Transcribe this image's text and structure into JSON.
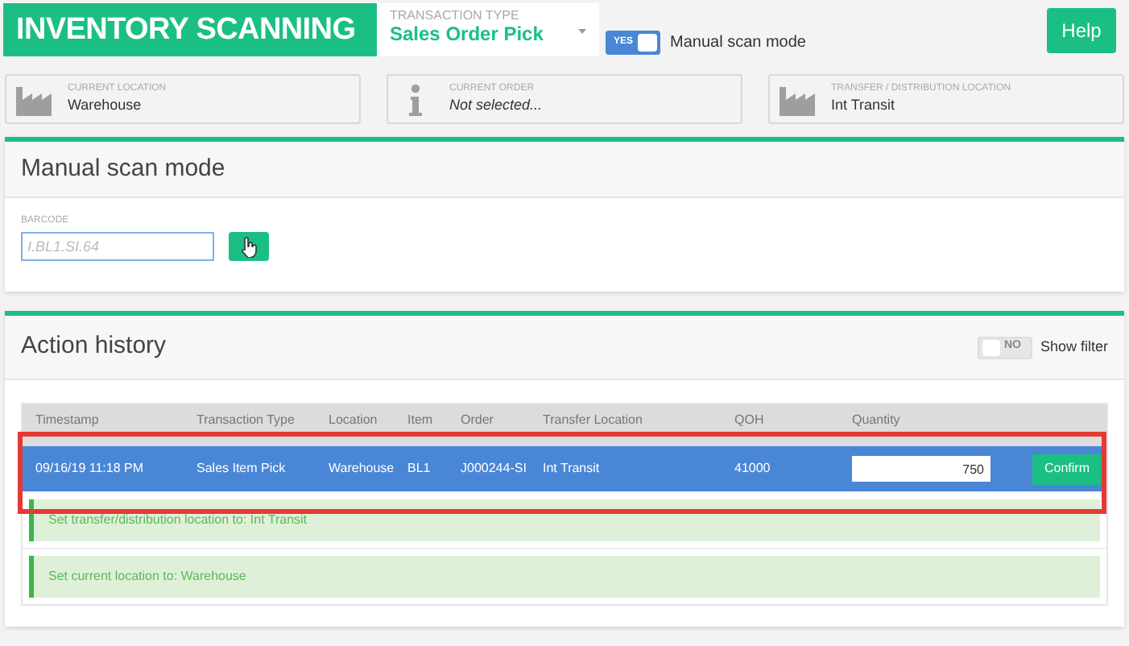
{
  "header": {
    "title": "INVENTORY SCANNING",
    "transaction_type": {
      "label": "TRANSACTION TYPE",
      "value": "Sales Order Pick"
    },
    "manual_toggle": {
      "on": true,
      "on_text": "YES",
      "label": "Manual scan mode"
    },
    "help_button": "Help"
  },
  "info_cards": [
    {
      "kind": "factory",
      "label": "CURRENT LOCATION",
      "value": "Warehouse",
      "italic": false
    },
    {
      "kind": "info",
      "label": "CURRENT ORDER",
      "value": "Not selected...",
      "italic": true
    },
    {
      "kind": "factory",
      "label": "TRANSFER / DISTRIBUTION LOCATION",
      "value": "Int Transit",
      "italic": false
    }
  ],
  "manual_panel": {
    "title": "Manual scan mode",
    "barcode": {
      "label": "BARCODE",
      "placeholder": "I.BL1.SI.64"
    }
  },
  "history_panel": {
    "title": "Action history",
    "filter_toggle": {
      "on": false,
      "off_text": "NO",
      "label": "Show filter"
    },
    "table": {
      "columns": [
        "Timestamp",
        "Transaction Type",
        "Location",
        "Item",
        "Order",
        "Transfer Location",
        "QOH",
        "Quantity"
      ],
      "rows": [
        {
          "selected": true,
          "cells": [
            "09/16/19 11:18 PM",
            "Sales Item Pick",
            "Warehouse",
            "BL1",
            "J000244-SI",
            "Int Transit",
            "41000"
          ],
          "quantity": "750",
          "action": "Confirm"
        }
      ]
    },
    "messages": [
      "Set transfer/distribution location to: Int Transit",
      "Set current location to: Warehouse"
    ]
  }
}
